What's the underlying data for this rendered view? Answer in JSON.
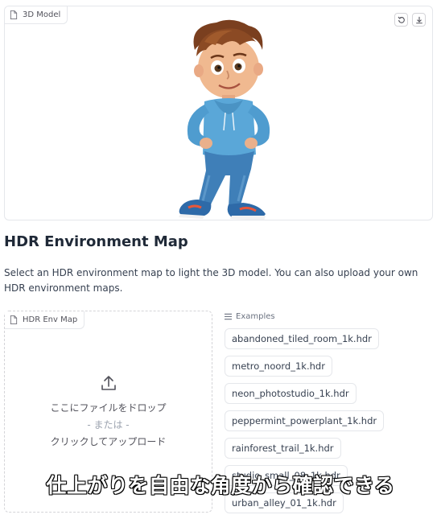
{
  "model_panel": {
    "label": "3D Model",
    "icons": [
      "file-icon",
      "reset-icon",
      "download-icon"
    ]
  },
  "hdr_section": {
    "title": "HDR Environment Map",
    "description": "Select an HDR environment map to light the 3D model. You can also upload your own HDR environment maps."
  },
  "hdr_upload": {
    "label": "HDR Env Map",
    "drop_text": "ここにファイルをドロップ",
    "or_text": "- または -",
    "click_text": "クリックしてアップロード"
  },
  "examples": {
    "label": "Examples",
    "items": [
      "abandoned_tiled_room_1k.hdr",
      "metro_noord_1k.hdr",
      "neon_photostudio_1k.hdr",
      "peppermint_powerplant_1k.hdr",
      "rainforest_trail_1k.hdr",
      "studio_small_08_1k.hdr",
      "urban_alley_01_1k.hdr"
    ]
  },
  "caption": "仕上がりを自由な角度から確認できる"
}
